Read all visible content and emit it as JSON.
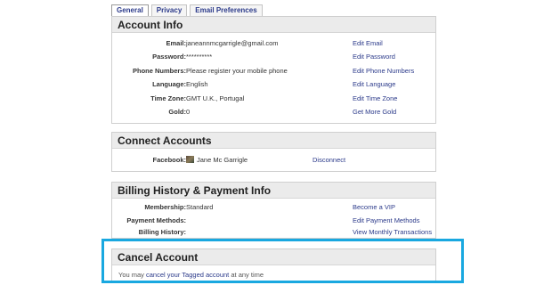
{
  "tabs": [
    {
      "label": "General",
      "active": true
    },
    {
      "label": "Privacy",
      "active": false
    },
    {
      "label": "Email Preferences",
      "active": false
    }
  ],
  "account_info": {
    "title": "Account Info",
    "rows": [
      {
        "label": "Email:",
        "value": "janeannmcgarrigle@gmail.com",
        "link": "Edit Email"
      },
      {
        "label": "Password:",
        "value": "**********",
        "link": "Edit Password"
      },
      {
        "label": "Phone Numbers:",
        "value": "Please register your mobile phone",
        "link": "Edit Phone Numbers"
      },
      {
        "label": "Language:",
        "value": "English",
        "link": "Edit Language"
      },
      {
        "label": "Time Zone:",
        "value": "GMT U.K., Portugal",
        "link": "Edit Time Zone"
      },
      {
        "label": "Gold:",
        "value": "0",
        "link": "Get More Gold"
      }
    ]
  },
  "connect_accounts": {
    "title": "Connect Accounts",
    "facebook_label": "Facebook:",
    "facebook_name": "Jane Mc Garrigle",
    "disconnect": "Disconnect"
  },
  "billing": {
    "title": "Billing History & Payment Info",
    "membership_label": "Membership:",
    "membership_value": "Standard",
    "payment_label": "Payment Methods:",
    "history_label": "Billing History:",
    "links": [
      "Become a VIP",
      "Edit Payment Methods",
      "View Monthly Transactions"
    ]
  },
  "cancel": {
    "title": "Cancel Account",
    "text_before": "You may ",
    "link_text": "cancel your Tagged account",
    "text_after": " at any time"
  },
  "colors": {
    "link": "#2b3a8a",
    "header_bg": "#ebebeb",
    "highlight": "#19a8e0"
  }
}
